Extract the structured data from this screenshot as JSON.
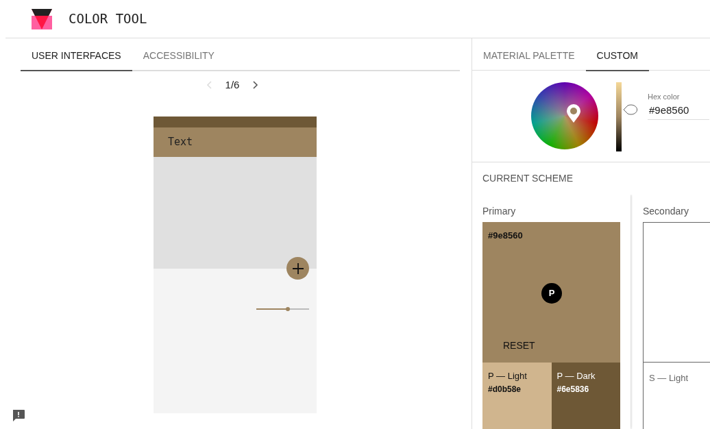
{
  "header": {
    "title": "COLOR TOOL"
  },
  "left_tabs": [
    {
      "label": "USER INTERFACES",
      "selected": true
    },
    {
      "label": "ACCESSIBILITY",
      "selected": false
    }
  ],
  "pager": {
    "text": "1/6",
    "prev_disabled": true
  },
  "preview": {
    "app_bar_text": "Text",
    "slider": {
      "level": 0.6
    }
  },
  "right_tabs": [
    {
      "label": "MATERIAL PALETTE",
      "selected": false
    },
    {
      "label": "CUSTOM",
      "selected": true
    }
  ],
  "picker": {
    "lightness": {
      "level": 0.6
    },
    "hex_label": "Hex color",
    "hex_value": "#9e8560"
  },
  "scheme": {
    "title": "CURRENT SCHEME",
    "primary": {
      "label": "Primary",
      "hex": "#9e8560",
      "color": "#9e8560",
      "badge": "P",
      "reset": "RESET",
      "variants": [
        {
          "label": "P — Light",
          "hex": "#d0b58e",
          "color": "#d0b58e",
          "dark_text": true
        },
        {
          "label": "P — Dark",
          "hex": "#6e5836",
          "color": "#6e5836",
          "dark_text": false
        }
      ]
    },
    "secondary": {
      "label": "Secondary",
      "variant_label": "S — Light"
    }
  }
}
